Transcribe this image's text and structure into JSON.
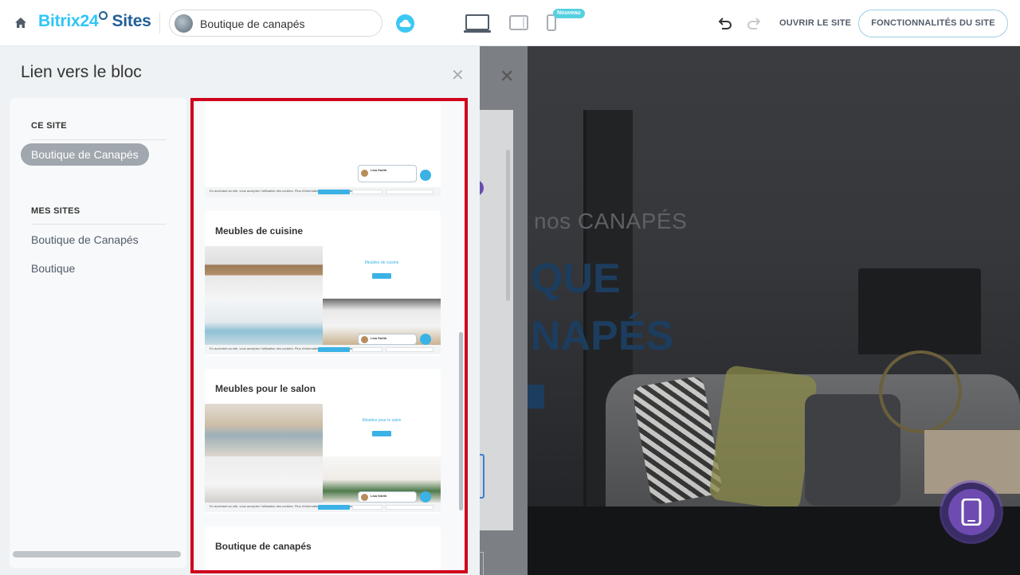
{
  "topbar": {
    "logo_part1": "Bitrix24",
    "logo_part2": "Sites",
    "site_select_label": "Boutique de canapés",
    "new_badge": "Nouveau",
    "open_site": "OUVRIR LE SITE",
    "features_button": "FONCTIONNALITÉS DU SITE"
  },
  "dialog": {
    "title": "Lien vers le bloc",
    "sections": {
      "this_site": "CE SITE",
      "my_sites": "MES SITES"
    },
    "this_site_items": [
      "Boutique de Canapés"
    ],
    "my_sites_items": [
      "Boutique de Canapés",
      "Boutique"
    ]
  },
  "blocks": {
    "card1": {
      "chat_name": "Lisa Smith",
      "cookie_text": "En accédant au site, vous acceptez l'utilisation des cookies. Plus d'informations sur notre politique des cookies."
    },
    "card2": {
      "title": "Meubles de cuisine",
      "mini_title": "Meubles de cuisine",
      "chat_name": "Lisa Smith",
      "cookie_text": "En accédant au site, vous acceptez l'utilisation des cookies. Plus d'informations sur notre politique des cookies."
    },
    "card3": {
      "title": "Meubles pour le salon",
      "mini_title": "Meubles pour le salon",
      "chat_name": "Lisa Smith",
      "cookie_text": "En accédant au site, vous acceptez l'utilisation des cookies. Plus d'informations sur notre politique des cookies."
    },
    "card4": {
      "title": "Boutique de canapés"
    }
  },
  "preview": {
    "hero_line1": "nos CANAPÉS",
    "hero_line2": "QUE",
    "hero_line3": "NAPÉS"
  },
  "colors": {
    "accent": "#2fc6f6",
    "brand_dark": "#215f98",
    "highlight_border": "#d0021b",
    "active_pill": "#a0a7ae"
  }
}
